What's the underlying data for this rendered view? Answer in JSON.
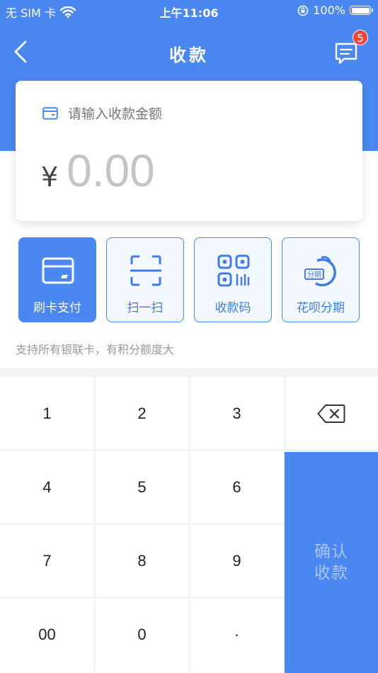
{
  "status_bar": {
    "carrier": "无 SIM 卡",
    "time": "上午11:06",
    "battery": "100%"
  },
  "nav": {
    "title": "收款",
    "badge_count": "5"
  },
  "amount_card": {
    "hint": "请输入收款金额",
    "currency": "¥",
    "amount": "0.00"
  },
  "payment_methods": [
    {
      "label": "刷卡支付",
      "icon": "card-icon",
      "active": true
    },
    {
      "label": "扫一扫",
      "icon": "scan-icon",
      "active": false
    },
    {
      "label": "收款码",
      "icon": "qr-code-icon",
      "active": false
    },
    {
      "label": "花呗分期",
      "icon": "huabei-icon",
      "icon_text": "分期",
      "active": false
    }
  ],
  "support_note": "支持所有银联卡，有积分额度大",
  "keypad": {
    "keys": [
      "1",
      "2",
      "3",
      "4",
      "5",
      "6",
      "7",
      "8",
      "9",
      "00",
      "0",
      "·"
    ],
    "confirm_label": "确认收款"
  },
  "colors": {
    "primary": "#4a87f1",
    "badge": "#f2443c",
    "confirm_text": "#a9c6f7"
  }
}
